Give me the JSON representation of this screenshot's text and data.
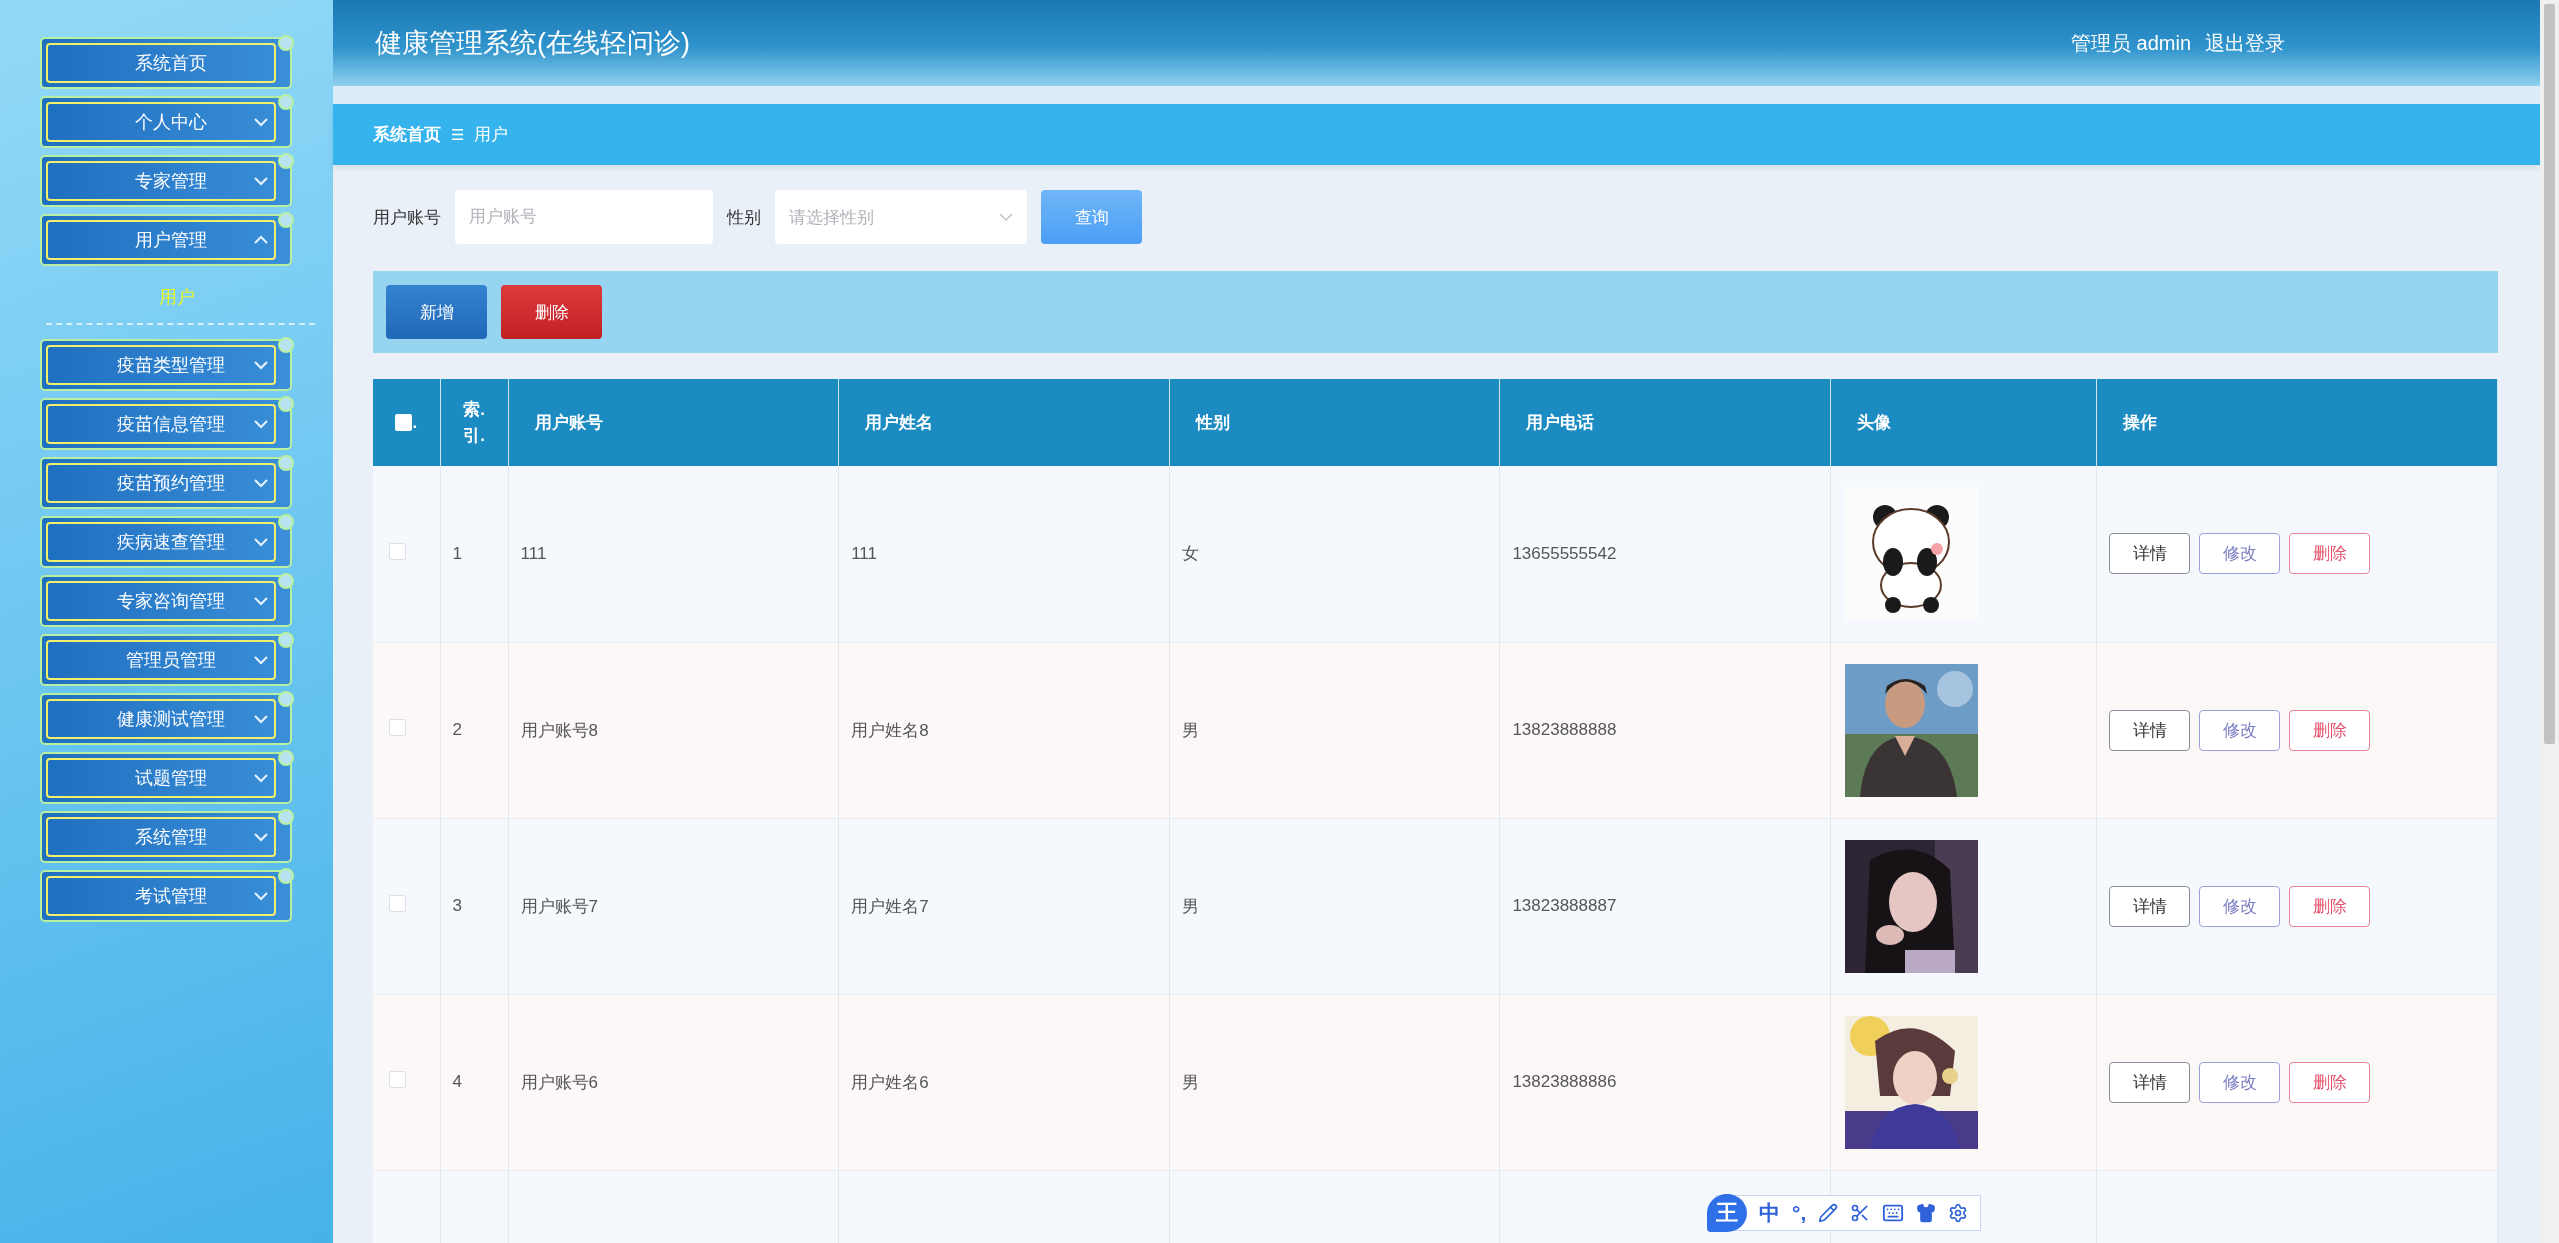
{
  "sidebar": {
    "items": [
      {
        "label": "系统首页",
        "kind": "link"
      },
      {
        "label": "个人中心",
        "kind": "group",
        "expanded": false
      },
      {
        "label": "专家管理",
        "kind": "group",
        "expanded": false
      },
      {
        "label": "用户管理",
        "kind": "group",
        "expanded": true,
        "children": [
          {
            "label": "用户",
            "selected": true
          }
        ]
      },
      {
        "label": "疫苗类型管理",
        "kind": "group",
        "expanded": false
      },
      {
        "label": "疫苗信息管理",
        "kind": "group",
        "expanded": false
      },
      {
        "label": "疫苗预约管理",
        "kind": "group",
        "expanded": false
      },
      {
        "label": "疾病速查管理",
        "kind": "group",
        "expanded": false
      },
      {
        "label": "专家咨询管理",
        "kind": "group",
        "expanded": false
      },
      {
        "label": "管理员管理",
        "kind": "group",
        "expanded": false
      },
      {
        "label": "健康测试管理",
        "kind": "group",
        "expanded": false
      },
      {
        "label": "试题管理",
        "kind": "group",
        "expanded": false
      },
      {
        "label": "系统管理",
        "kind": "group",
        "expanded": false
      },
      {
        "label": "考试管理",
        "kind": "group",
        "expanded": false
      }
    ]
  },
  "header": {
    "title": "健康管理系统(在线轻问诊)",
    "user_label": "管理员 admin",
    "logout": "退出登录"
  },
  "breadcrumb": {
    "items": [
      "系统首页",
      "用户"
    ],
    "separator": "☰"
  },
  "search": {
    "fields": [
      {
        "kind": "text",
        "label": "用户账号",
        "placeholder": "用户账号"
      },
      {
        "kind": "select",
        "label": "性别",
        "placeholder": "请选择性别"
      }
    ],
    "button": "查询"
  },
  "actions": [
    {
      "label": "新增",
      "kind": "add"
    },
    {
      "label": "删除",
      "kind": "delete"
    }
  ],
  "table": {
    "select_all": {
      "label": ".",
      "checked": false
    },
    "columns": [
      "索.引.",
      "用户账号",
      "用户姓名",
      "性别",
      "用户电话",
      "头像",
      "操作"
    ],
    "rows": [
      {
        "checked": false,
        "index": "1",
        "account": "111",
        "name": "111",
        "gender": "女",
        "phone": "13655555542",
        "avatar": {
          "kind": "picture"
        },
        "actions": [
          {
            "label": "详情",
            "kind": "detail"
          },
          {
            "label": "修改",
            "kind": "edit"
          },
          {
            "label": "删除",
            "kind": "delete"
          }
        ]
      },
      {
        "checked": false,
        "index": "2",
        "account": "用户账号8",
        "name": "用户姓名8",
        "gender": "男",
        "phone": "13823888888",
        "avatar": {
          "kind": "picture"
        },
        "actions": [
          {
            "label": "详情",
            "kind": "detail"
          },
          {
            "label": "修改",
            "kind": "edit"
          },
          {
            "label": "删除",
            "kind": "delete"
          }
        ]
      },
      {
        "checked": false,
        "index": "3",
        "account": "用户账号7",
        "name": "用户姓名7",
        "gender": "男",
        "phone": "13823888887",
        "avatar": {
          "kind": "picture"
        },
        "actions": [
          {
            "label": "详情",
            "kind": "detail"
          },
          {
            "label": "修改",
            "kind": "edit"
          },
          {
            "label": "删除",
            "kind": "delete"
          }
        ]
      },
      {
        "checked": false,
        "index": "4",
        "account": "用户账号6",
        "name": "用户姓名6",
        "gender": "男",
        "phone": "13823888886",
        "avatar": {
          "kind": "picture"
        },
        "actions": [
          {
            "label": "详情",
            "kind": "detail"
          },
          {
            "label": "修改",
            "kind": "edit"
          },
          {
            "label": "删除",
            "kind": "delete"
          }
        ]
      }
    ]
  },
  "ime_toolbar": {
    "logo": "王",
    "mode": "中",
    "punctuation": "°,"
  }
}
